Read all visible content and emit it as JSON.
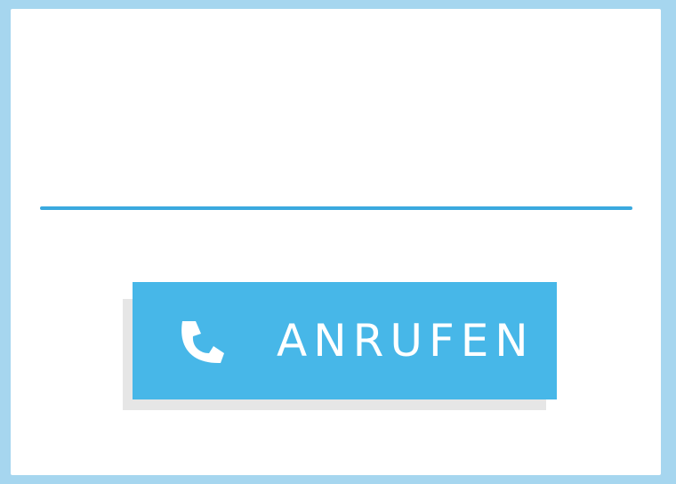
{
  "call_button": {
    "label": "ANRUFEN",
    "icon": "phone-icon"
  },
  "colors": {
    "page_background": "#a6d6ef",
    "card_background": "#ffffff",
    "accent": "#47b7e8",
    "underline": "#3aa9df",
    "button_shadow": "#e6e6e6"
  }
}
